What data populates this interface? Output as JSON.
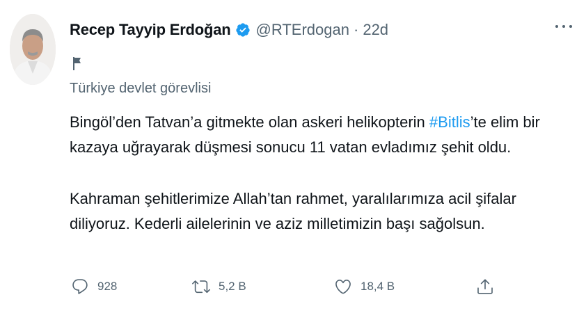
{
  "tweet": {
    "author_name": "Recep Tayyip Erdoğan",
    "verified": true,
    "handle": "@RTErdogan",
    "separator": "·",
    "time": "22d",
    "account_label": "Türkiye devlet görevlisi",
    "body": {
      "p1_before": "Bingöl’den Tatvan’a gitmekte olan askeri helikopterin ",
      "p1_hashtag": "#Bitlis",
      "p1_after": "’te elim bir kazaya uğrayarak düşmesi sonucu 11 vatan evladımız şehit oldu.",
      "p2": "Kahraman şehitlerimize Allah’tan rahmet, yaralılarımıza acil şifalar diliyoruz. Kederli ailelerinin ve aziz milletimizin başı sağolsun."
    },
    "actions": {
      "reply_count": "928",
      "retweet_count": "5,2 B",
      "like_count": "18,4 B"
    }
  },
  "icons": {
    "verified": "verified-badge-icon",
    "more": "more-options-icon",
    "label_flag": "flag-icon",
    "reply": "reply-icon",
    "retweet": "retweet-icon",
    "like": "heart-icon",
    "share": "share-icon"
  },
  "colors": {
    "accent": "#1d9bf0",
    "text_primary": "#0f1419",
    "text_secondary": "#536471"
  }
}
